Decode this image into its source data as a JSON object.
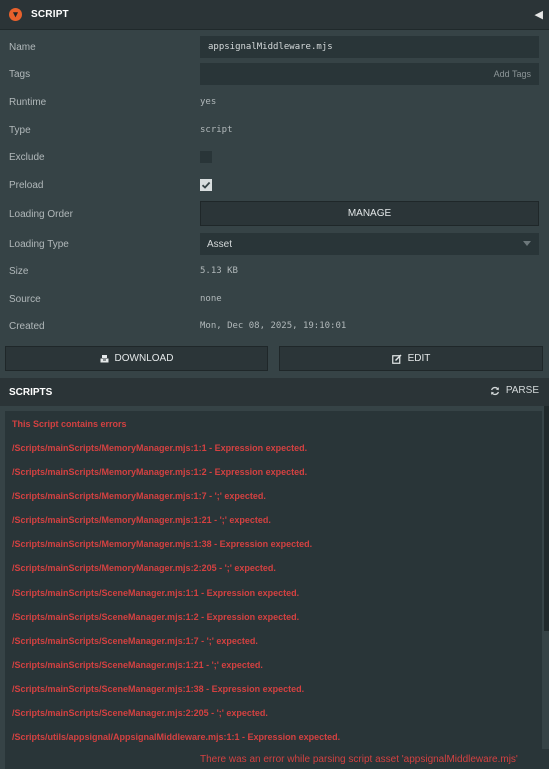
{
  "header": {
    "title": "SCRIPT",
    "badge_glyph": "▾",
    "collapse_glyph": "◀"
  },
  "fields": {
    "name": {
      "label": "Name",
      "value": "appsignalMiddleware.mjs"
    },
    "tags": {
      "label": "Tags",
      "placeholder": "Add Tags"
    },
    "runtime": {
      "label": "Runtime",
      "value": "yes"
    },
    "type": {
      "label": "Type",
      "value": "script"
    },
    "exclude": {
      "label": "Exclude",
      "checked": false
    },
    "preload": {
      "label": "Preload",
      "checked": true
    },
    "loading_order": {
      "label": "Loading Order",
      "button": "MANAGE"
    },
    "loading_type": {
      "label": "Loading Type",
      "value": "Asset"
    },
    "size": {
      "label": "Size",
      "value": "5.13 KB"
    },
    "source": {
      "label": "Source",
      "value": "none"
    },
    "created": {
      "label": "Created",
      "value": "Mon, Dec 08, 2025, 19:10:01"
    }
  },
  "actions": {
    "download": "DOWNLOAD",
    "edit": "EDIT"
  },
  "scripts": {
    "title": "SCRIPTS",
    "parse": "PARSE",
    "errors": [
      "This Script contains errors",
      "/Scripts/mainScripts/MemoryManager.mjs:1:1 - Expression expected.",
      "/Scripts/mainScripts/MemoryManager.mjs:1:2 - Expression expected.",
      "/Scripts/mainScripts/MemoryManager.mjs:1:7 - ';' expected.",
      "/Scripts/mainScripts/MemoryManager.mjs:1:21 - ';' expected.",
      "/Scripts/mainScripts/MemoryManager.mjs:1:38 - Expression expected.",
      "/Scripts/mainScripts/MemoryManager.mjs:2:205 - ';' expected.",
      "/Scripts/mainScripts/SceneManager.mjs:1:1 - Expression expected.",
      "/Scripts/mainScripts/SceneManager.mjs:1:2 - Expression expected.",
      "/Scripts/mainScripts/SceneManager.mjs:1:7 - ';' expected.",
      "/Scripts/mainScripts/SceneManager.mjs:1:21 - ';' expected.",
      "/Scripts/mainScripts/SceneManager.mjs:1:38 - Expression expected.",
      "/Scripts/mainScripts/SceneManager.mjs:2:205 - ';' expected.",
      "/Scripts/utils/appsignal/AppsignalMiddleware.mjs:1:1 - Expression expected."
    ]
  },
  "status": {
    "message": "There was an error while parsing script asset 'appsignalMiddleware.mjs'"
  },
  "colors": {
    "accent": "#e8612c",
    "error": "#d34141",
    "panel": "#364346",
    "field": "#293538"
  }
}
